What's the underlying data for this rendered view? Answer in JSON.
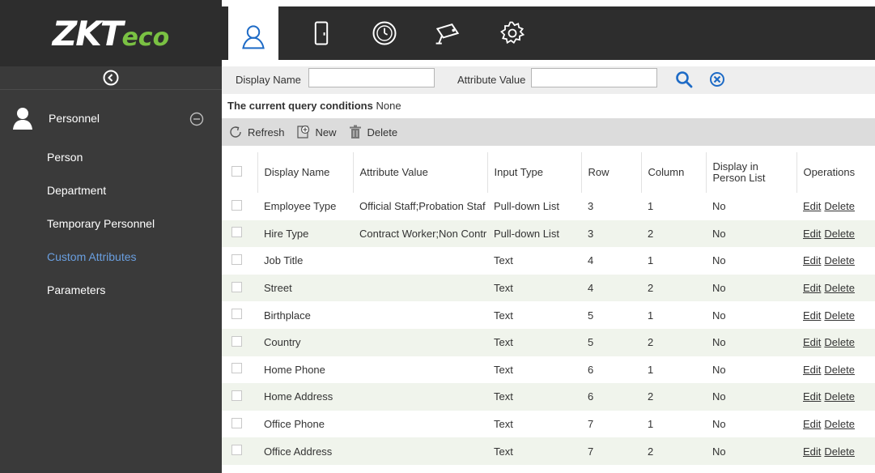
{
  "header": {
    "logo_text": "ZK",
    "logo_t": "T",
    "logo_eco": "eco",
    "nav_icons": [
      "personnel-icon",
      "door-icon",
      "clock-icon",
      "camera-icon",
      "settings-icon"
    ]
  },
  "sidebar": {
    "section": "Personnel",
    "items": [
      {
        "label": "Person"
      },
      {
        "label": "Department"
      },
      {
        "label": "Temporary Personnel"
      },
      {
        "label": "Custom Attributes"
      },
      {
        "label": "Parameters"
      }
    ],
    "active_index": 3
  },
  "search": {
    "display_name_label": "Display Name",
    "display_name_value": "",
    "attribute_value_label": "Attribute Value",
    "attribute_value_value": ""
  },
  "query": {
    "label": "The current query conditions",
    "value": "None"
  },
  "toolbar": {
    "refresh": "Refresh",
    "new": "New",
    "delete": "Delete"
  },
  "table": {
    "headers": {
      "display_name": "Display Name",
      "attribute_value": "Attribute Value",
      "input_type": "Input Type",
      "row": "Row",
      "column": "Column",
      "display_in_list_1": "Display in",
      "display_in_list_2": "Person List",
      "operations": "Operations"
    },
    "edit_label": "Edit",
    "delete_label": "Delete",
    "rows": [
      {
        "name": "Employee Type",
        "value": "Official Staff;Probation Staf",
        "type": "Pull-down List",
        "row": "3",
        "col": "1",
        "show": "No"
      },
      {
        "name": "Hire Type",
        "value": "Contract Worker;Non Contr",
        "type": "Pull-down List",
        "row": "3",
        "col": "2",
        "show": "No"
      },
      {
        "name": "Job Title",
        "value": "",
        "type": "Text",
        "row": "4",
        "col": "1",
        "show": "No"
      },
      {
        "name": "Street",
        "value": "",
        "type": "Text",
        "row": "4",
        "col": "2",
        "show": "No"
      },
      {
        "name": "Birthplace",
        "value": "",
        "type": "Text",
        "row": "5",
        "col": "1",
        "show": "No"
      },
      {
        "name": "Country",
        "value": "",
        "type": "Text",
        "row": "5",
        "col": "2",
        "show": "No"
      },
      {
        "name": "Home Phone",
        "value": "",
        "type": "Text",
        "row": "6",
        "col": "1",
        "show": "No"
      },
      {
        "name": "Home Address",
        "value": "",
        "type": "Text",
        "row": "6",
        "col": "2",
        "show": "No"
      },
      {
        "name": "Office Phone",
        "value": "",
        "type": "Text",
        "row": "7",
        "col": "1",
        "show": "No"
      },
      {
        "name": "Office Address",
        "value": "",
        "type": "Text",
        "row": "7",
        "col": "2",
        "show": "No"
      }
    ]
  },
  "colors": {
    "header_bg": "#2d2d2d",
    "sidebar_bg": "#3a3a3a",
    "active_menu": "#6a9fe0",
    "logo_green": "#7ac143",
    "search_icon": "#1e6bc6"
  }
}
